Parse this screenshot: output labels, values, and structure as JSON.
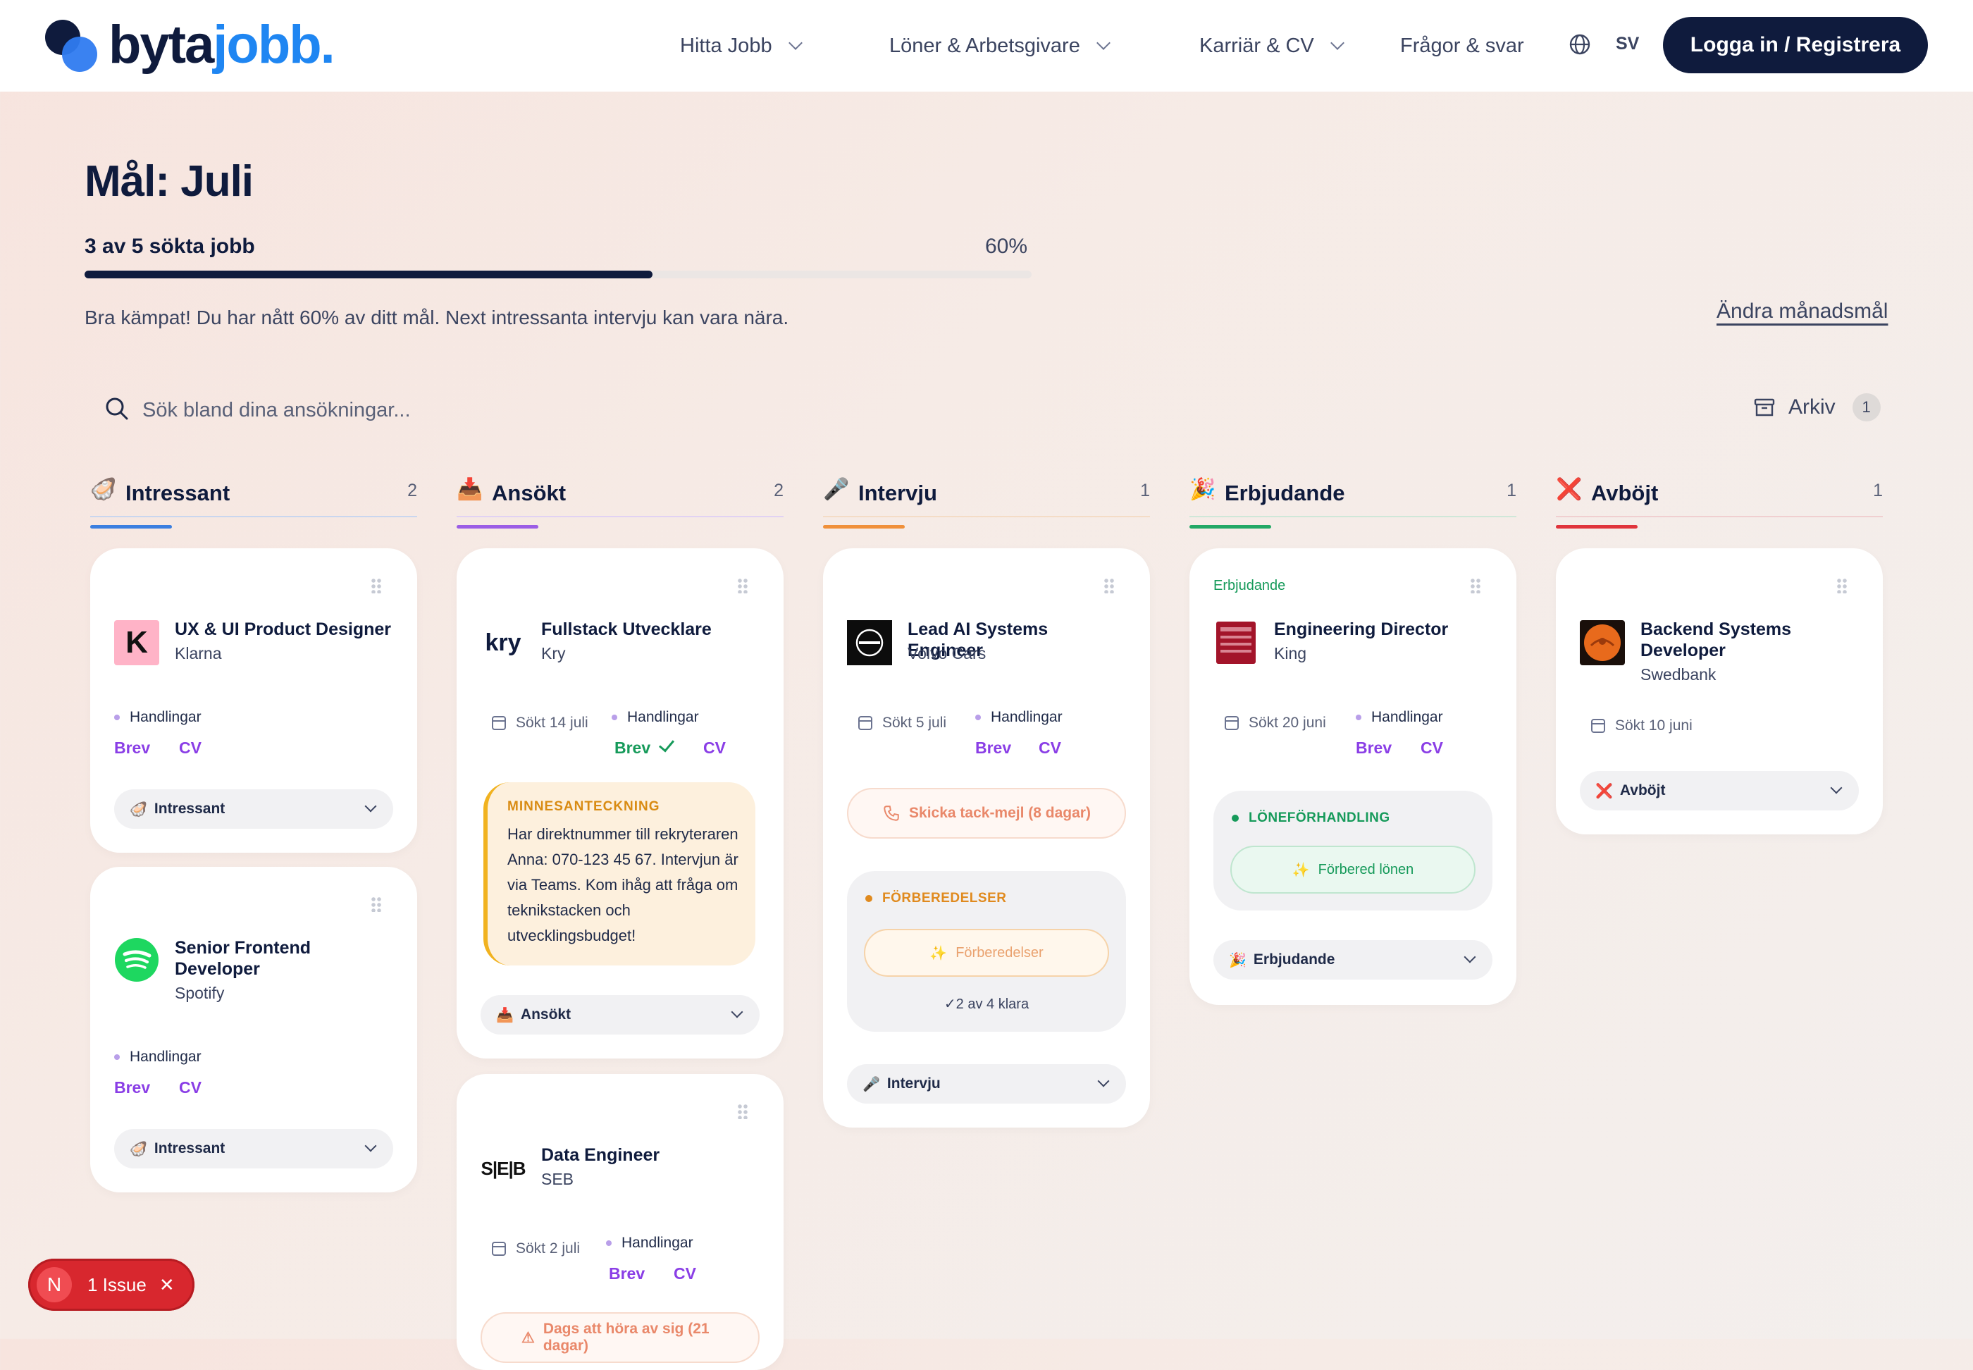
{
  "header": {
    "logo_a": "byta",
    "logo_b": "jobb.",
    "nav": [
      {
        "label": "Hitta Jobb",
        "dropdown": true
      },
      {
        "label": "Löner & Arbetsgivare",
        "dropdown": true
      },
      {
        "label": "Karriär & CV",
        "dropdown": true
      },
      {
        "label": "Frågor & svar",
        "dropdown": false
      }
    ],
    "language": "SV",
    "login_label": "Logga in / Registrera"
  },
  "goal": {
    "title": "Mål: Juli",
    "count_text": "3 av 5 sökta jobb",
    "percent_text": "60%",
    "progress": 0.6,
    "message": "Bra kämpat! Du har nått 60% av ditt mål. Next intressanta intervju kan vara nära.",
    "change_label": "Ändra månadsmål"
  },
  "search": {
    "placeholder": "Sök bland dina ansökningar..."
  },
  "archive": {
    "label": "Arkiv",
    "count": "1"
  },
  "columns": [
    {
      "emoji": "🦪",
      "title": "Intressant",
      "count": "2",
      "color": "#3b7fe0"
    },
    {
      "emoji": "📥",
      "title": "Ansökt",
      "count": "2",
      "color": "#9b5de5"
    },
    {
      "emoji": "🎤",
      "title": "Intervju",
      "count": "1",
      "color": "#f0903a"
    },
    {
      "emoji": "🎉",
      "title": "Erbjudande",
      "count": "1",
      "color": "#22a866"
    },
    {
      "emoji": "❌",
      "title": "Avböjt",
      "count": "1",
      "color": "#e0343c"
    }
  ],
  "common": {
    "actions": "Handlingar",
    "letter": "Brev",
    "cv": "CV"
  },
  "cards": {
    "klarna": {
      "title": "UX & UI Product Designer",
      "company": "Klarna",
      "status": "Intressant",
      "status_emoji": "🦪"
    },
    "spotify": {
      "title": "Senior Frontend Developer",
      "company": "Spotify",
      "status": "Intressant",
      "status_emoji": "🦪"
    },
    "kry": {
      "logo": "kry",
      "title": "Fullstack Utvecklare",
      "company": "Kry",
      "applied": "Sökt 14 juli",
      "memo_label": "MINNESANTECKNING",
      "memo_text": "Har direktnummer till rekryteraren Anna: 070-123 45 67. Intervjun är via Teams. Kom ihåg att fråga om teknikstacken och utvecklingsbudget!",
      "status": "Ansökt",
      "status_emoji": "📥"
    },
    "seb": {
      "logo": "S|E|B",
      "title": "Data Engineer",
      "company": "SEB",
      "applied": "Sökt 2 juli",
      "reminder": "Dags att höra av sig (21 dagar)"
    },
    "volvo": {
      "title": "Lead AI Systems Engineer",
      "company": "Volvo Cars",
      "applied": "Sökt 5 juli",
      "reminder": "Skicka tack-mejl (8 dagar)",
      "prep_label": "FÖRBEREDELSER",
      "prep_button": "Förberedelser",
      "prep_progress": "✓2 av 4 klara",
      "status": "Intervju",
      "status_emoji": "🎤"
    },
    "king": {
      "tag": "Erbjudande",
      "title": "Engineering Director",
      "company": "King",
      "applied": "Sökt 20 juni",
      "panel_label": "LÖNEFÖRHANDLING",
      "panel_button": "Förbered lönen",
      "status": "Erbjudande",
      "status_emoji": "🎉"
    },
    "swedbank": {
      "title": "Backend Systems Developer",
      "company": "Swedbank",
      "applied": "Sökt 10 juni",
      "status": "Avböjt",
      "status_emoji": "❌"
    }
  },
  "issue": {
    "badge": "N",
    "label": "1 Issue"
  }
}
